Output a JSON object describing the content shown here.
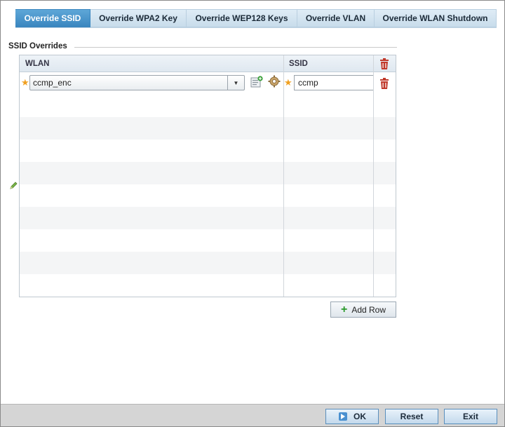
{
  "tabs": [
    {
      "label": "Override SSID",
      "active": true
    },
    {
      "label": "Override WPA2 Key",
      "active": false
    },
    {
      "label": "Override WEP128 Keys",
      "active": false
    },
    {
      "label": "Override VLAN",
      "active": false
    },
    {
      "label": "Override WLAN Shutdown",
      "active": false
    }
  ],
  "section": {
    "title": "SSID Overrides"
  },
  "grid": {
    "columns": [
      "WLAN",
      "SSID"
    ],
    "rows": [
      {
        "wlan": "ccmp_enc",
        "ssid": "ccmp"
      }
    ]
  },
  "add_row_label": "Add Row",
  "footer": {
    "ok": "OK",
    "reset": "Reset",
    "exit": "Exit"
  },
  "colors": {
    "accent": "#3a86bf",
    "required": "#f0a020",
    "delete": "#c0392b",
    "add": "#2a9a2a"
  }
}
